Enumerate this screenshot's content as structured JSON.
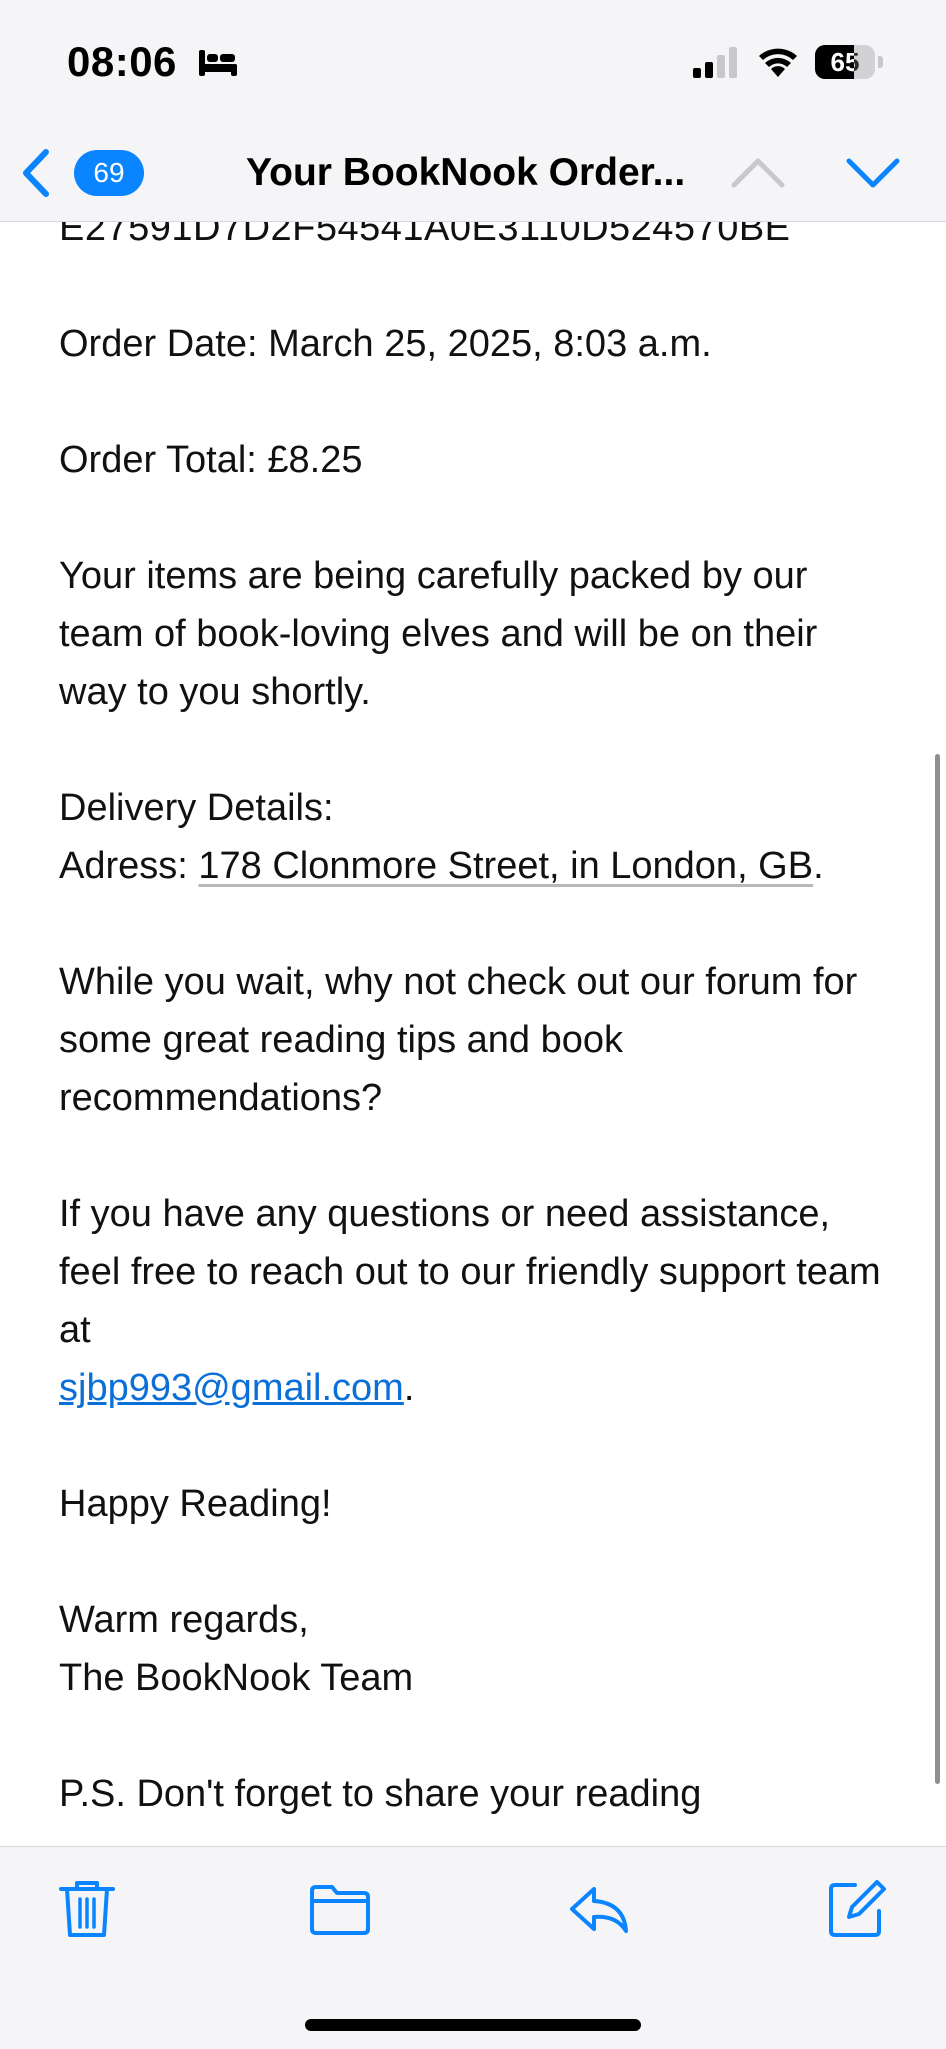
{
  "status_bar": {
    "time": "08:06",
    "battery_level": "65",
    "icons": [
      "sleep-mode-icon",
      "cellular-signal-icon",
      "wifi-icon",
      "battery-icon"
    ]
  },
  "nav": {
    "back_badge_count": "69",
    "title": "Your BookNook Order...",
    "icons": [
      "back-chevron-icon",
      "chevron-up-icon",
      "chevron-down-icon"
    ]
  },
  "email": {
    "order_id_line": "E27591D7D2F54541A0E3110D524570BE",
    "order_date": "Order Date: March 25, 2025, 8:03 a.m.",
    "order_total": "Order Total: £8.25",
    "packing_message": "Your items are being carefully packed by our team of book-loving elves and will be on their way to you shortly.",
    "delivery_heading": "Delivery Details:",
    "address_label": "Adress: ",
    "address_link": "178 Clonmore Street, in London, GB",
    "address_suffix": ".",
    "forum_message": "While you wait, why not check out our forum for some great reading tips and book recommendations?",
    "support_message": "If you have any questions or need assistance, feel free to reach out to our friendly support team at",
    "support_email": "sjbp993@gmail.com",
    "support_suffix": ".",
    "happy_reading": "Happy Reading!",
    "signoff": "Warm regards,",
    "team_name": "The BookNook Team",
    "ps_line": "P.S. Don't forget to share your reading"
  },
  "toolbar": {
    "icons": [
      "trash-icon",
      "folder-icon",
      "reply-icon",
      "compose-icon"
    ]
  },
  "colors": {
    "accent": "#0a84ff",
    "link": "#0a6fd6",
    "bar_background": "#f5f5f7"
  }
}
